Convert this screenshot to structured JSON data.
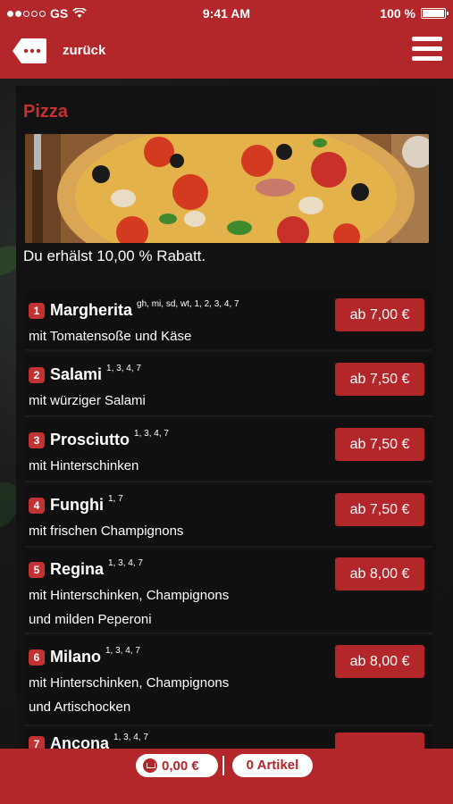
{
  "status_bar": {
    "carrier": "GS",
    "time": "9:41 AM",
    "battery": "100 %"
  },
  "nav": {
    "back_label": "zurück"
  },
  "category": {
    "title": "Pizza",
    "discount_text": "Du erhälst 10,00 % Rabatt."
  },
  "items": [
    {
      "num": "1",
      "name": "Margherita",
      "allergens": "gh, mi, sd, wt, 1, 2, 3, 4, 7",
      "desc": "mit Tomatensoße und Käse",
      "price": "ab 7,00 €"
    },
    {
      "num": "2",
      "name": "Salami",
      "allergens": "1, 3, 4, 7",
      "desc": "mit würziger Salami",
      "price": "ab 7,50 €"
    },
    {
      "num": "3",
      "name": "Prosciutto",
      "allergens": "1, 3, 4, 7",
      "desc": "mit Hinterschinken",
      "price": "ab 7,50 €"
    },
    {
      "num": "4",
      "name": "Funghi",
      "allergens": "1, 7",
      "desc": "mit frischen Champignons",
      "price": "ab 7,50 €"
    },
    {
      "num": "5",
      "name": "Regina",
      "allergens": "1, 3, 4, 7",
      "desc": "mit Hinterschinken, Champignons\nund milden Peperoni",
      "price": "ab 8,00 €"
    },
    {
      "num": "6",
      "name": "Milano",
      "allergens": "1, 3, 4, 7",
      "desc": "mit Hinterschinken, Champignons\nund Artischocken",
      "price": "ab 8,00 €"
    },
    {
      "num": "7",
      "name": "Ancona",
      "allergens": "1, 3, 4, 7",
      "desc": "",
      "price": ""
    }
  ],
  "cart": {
    "total": "0,00 €",
    "articles": "0 Artikel"
  },
  "colors": {
    "brand_red": "#b3262a",
    "accent_red": "#c23232"
  }
}
